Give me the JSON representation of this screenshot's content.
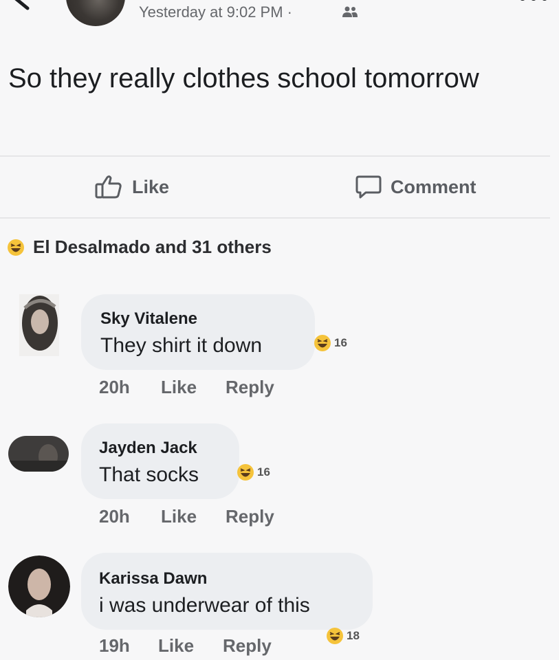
{
  "post": {
    "timestamp": "Yesterday at 9:02 PM ·",
    "text": "So they really clothes school tomorrow"
  },
  "actions": {
    "like_label": "Like",
    "comment_label": "Comment"
  },
  "reactions": {
    "summary": "El Desalmado and 31 others",
    "icon": "haha-emoji-icon"
  },
  "comments": [
    {
      "name": "Sky Vitalene",
      "text": "They shirt it down",
      "reaction_count": "16",
      "time": "20h",
      "like_label": "Like",
      "reply_label": "Reply"
    },
    {
      "name": "Jayden Jack",
      "text": "That socks",
      "reaction_count": "16",
      "time": "20h",
      "like_label": "Like",
      "reply_label": "Reply"
    },
    {
      "name": "Karissa Dawn",
      "text": "i was underwear of this",
      "reaction_count": "18",
      "time": "19h",
      "like_label": "Like",
      "reply_label": "Reply"
    }
  ],
  "colors": {
    "background": "#f7f7f8",
    "bubble": "#eceef1",
    "secondary_text": "#65676b",
    "emoji_yellow": "#f5c33b"
  }
}
